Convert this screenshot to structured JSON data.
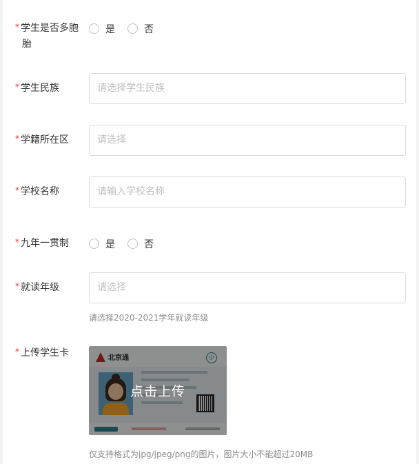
{
  "required_mark": "*",
  "fields": {
    "multiple_birth": {
      "label_line1": "学生是否多胞",
      "label_line2": "胎",
      "options": [
        "是",
        "否"
      ]
    },
    "ethnicity": {
      "label": "学生民族",
      "placeholder": "请选择学生民族"
    },
    "district": {
      "label": "学籍所在区",
      "placeholder": "请选择"
    },
    "school_name": {
      "label": "学校名称",
      "placeholder": "请输入学校名称"
    },
    "nine_year": {
      "label": "九年一贯制",
      "options": [
        "是",
        "否"
      ]
    },
    "grade": {
      "label": "就读年级",
      "placeholder": "请选择",
      "hint": "请选择2020-2021学年就读年级"
    },
    "student_card": {
      "label": "上传学生卡",
      "upload_text": "点击上传",
      "hint": "仅支持格式为jpg/jpeg/png的图片，图片大小不能超过20MB"
    }
  },
  "card_image": {
    "brand": "北京通",
    "badge": "小"
  },
  "colors": {
    "required": "#e53935",
    "border": "#dcdcdc",
    "placeholder": "#c0c0c0",
    "hint": "#8a8a8a"
  }
}
